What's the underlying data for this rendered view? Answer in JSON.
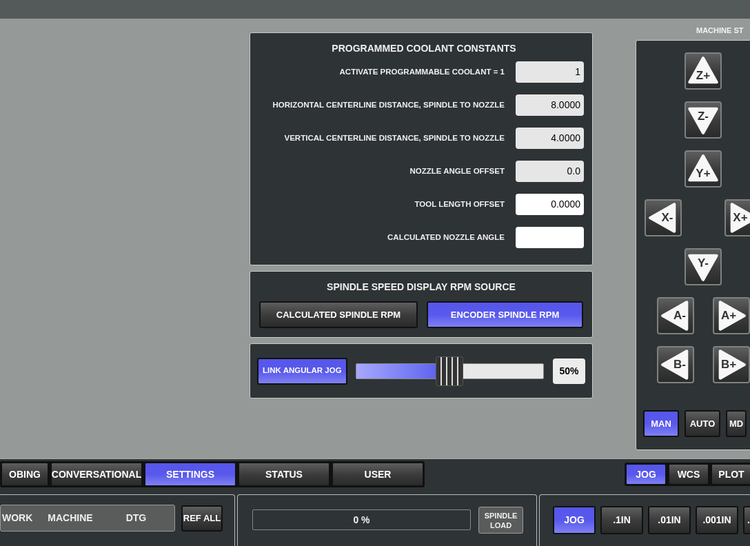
{
  "machine_status_title": "MACHINE ST",
  "coolant": {
    "title": "PROGRAMMED COOLANT CONSTANTS",
    "fields": [
      {
        "label": "ACTIVATE PROGRAMMABLE COOLANT = 1",
        "value": "1",
        "editable": false
      },
      {
        "label": "HORIZONTAL CENTERLINE DISTANCE, SPINDLE TO NOZZLE",
        "value": "8.0000",
        "editable": false
      },
      {
        "label": "VERTICAL CENTERLINE DISTANCE, SPINDLE TO NOZZLE",
        "value": "4.0000",
        "editable": false
      },
      {
        "label": "NOZZLE ANGLE OFFSET",
        "value": "0.0",
        "editable": false
      },
      {
        "label": "TOOL LENGTH OFFSET",
        "value": "0.0000",
        "editable": true
      },
      {
        "label": "CALCULATED NOZZLE ANGLE",
        "editable": true
      }
    ]
  },
  "rpm_source": {
    "title": "SPINDLE SPEED DISPLAY RPM SOURCE",
    "options": [
      {
        "label": "CALCULATED SPINDLE RPM",
        "selected": false
      },
      {
        "label": "ENCODER SPINDLE RPM",
        "selected": true
      }
    ]
  },
  "angular_jog": {
    "toggle": {
      "label": "LINK ANGULAR JOG",
      "on": true
    },
    "level": 0.5,
    "reading": "50%"
  },
  "jog_pad": [
    {
      "kind": "single",
      "buttons": [
        {
          "label": "Z+",
          "kind": "up"
        }
      ]
    },
    {
      "kind": "single",
      "buttons": [
        {
          "label": "Z-",
          "kind": "down"
        }
      ]
    },
    {
      "kind": "single",
      "buttons": [
        {
          "label": "Y+",
          "kind": "up"
        }
      ]
    },
    {
      "kind": "wide",
      "buttons": [
        {
          "label": "X-",
          "kind": "left"
        },
        {
          "label": "X+",
          "kind": "right"
        }
      ]
    },
    {
      "kind": "single",
      "buttons": [
        {
          "label": "Y-",
          "kind": "down"
        }
      ]
    },
    {
      "kind": "pair",
      "buttons": [
        {
          "label": "A-",
          "kind": "left"
        },
        {
          "label": "A+",
          "kind": "right"
        }
      ]
    },
    {
      "kind": "pair",
      "buttons": [
        {
          "label": "B-",
          "kind": "left"
        },
        {
          "label": "B+",
          "kind": "right"
        }
      ]
    }
  ],
  "modes": [
    {
      "label": "MAN",
      "selected": true
    },
    {
      "label": "AUTO",
      "selected": false
    },
    {
      "label": "MD",
      "selected": false
    }
  ],
  "main_tabs": [
    {
      "label": "OBING",
      "selected": false
    },
    {
      "label": "CONVERSATIONAL",
      "selected": false
    },
    {
      "label": "SETTINGS",
      "selected": true
    },
    {
      "label": "STATUS",
      "selected": false
    },
    {
      "label": "USER",
      "selected": false
    }
  ],
  "view_tabs": [
    {
      "label": "JOG",
      "selected": true
    },
    {
      "label": "WCS",
      "selected": false
    },
    {
      "label": "PLOT",
      "selected": false
    }
  ],
  "dro": {
    "columns": [
      "WORK",
      "MACHINE",
      "DTG"
    ],
    "ref_all": "REF ALL"
  },
  "spindle_load": {
    "reading": "0 %",
    "button": "SPINDLE LOAD"
  },
  "increments": [
    {
      "label": "JOG",
      "selected": true
    },
    {
      "label": ".1IN",
      "selected": false
    },
    {
      "label": ".01IN",
      "selected": false
    },
    {
      "label": ".001IN",
      "selected": false
    },
    {
      "label": ".",
      "selected": false
    }
  ]
}
